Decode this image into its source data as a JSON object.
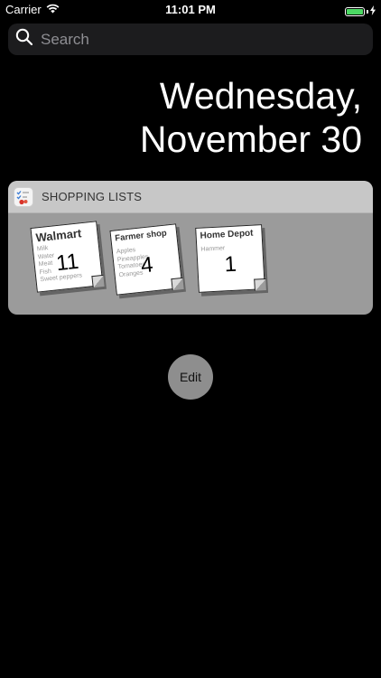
{
  "status_bar": {
    "carrier": "Carrier",
    "time": "11:01 PM",
    "battery_color": "#4cd964"
  },
  "search": {
    "placeholder": "Search",
    "icon": "search-icon"
  },
  "date": {
    "line1": "Wednesday,",
    "line2": "November 30"
  },
  "widget": {
    "title": "SHOPPING LISTS",
    "app_icon": "checklist-icon",
    "lists": [
      {
        "name": "Walmart",
        "items": [
          "Milk",
          "Water",
          "Meat",
          "Fish",
          "Sweet peppers"
        ],
        "count": "11"
      },
      {
        "name": "Farmer shop",
        "items": [
          "Apples",
          "Pineapples",
          "Tomatoes",
          "Oranges"
        ],
        "count": "4"
      },
      {
        "name": "Home Depot",
        "items": [
          "Hammer"
        ],
        "count": "1"
      }
    ]
  },
  "edit": {
    "label": "Edit"
  }
}
